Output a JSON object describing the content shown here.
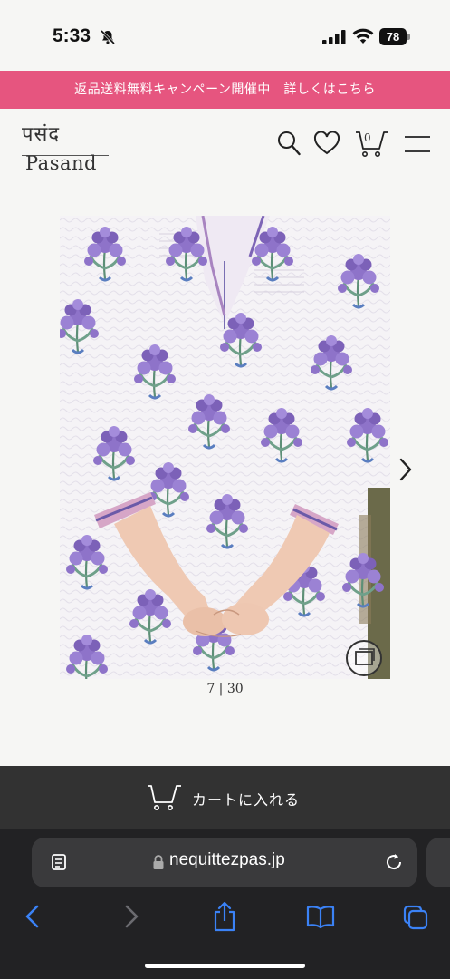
{
  "status_bar": {
    "time": "5:33",
    "battery": "78"
  },
  "promo": {
    "text": "返品送料無料キャンペーン開催中　詳しくはこちら"
  },
  "brand": {
    "hindi": "पसंद",
    "latin": "Pasand"
  },
  "header": {
    "cart_count": "0"
  },
  "gallery": {
    "counter": "7 | 30"
  },
  "cart_bar": {
    "label": "カートに入れる"
  },
  "browser": {
    "url": "nequittezpas.jp"
  },
  "icons": {
    "bell": "bell-slash-icon",
    "signal": "signal-icon",
    "wifi": "wifi-icon",
    "search": "search-icon",
    "heart": "heart-icon",
    "cart": "cart-icon",
    "menu": "menu-icon",
    "next": "chevron-right-icon",
    "zoom": "expand-icon",
    "reader": "page-menu-icon",
    "lock": "lock-icon",
    "reload": "reload-icon",
    "back": "back-icon",
    "forward": "forward-icon",
    "share": "share-icon",
    "bookmarks": "bookmarks-icon",
    "tabs": "tabs-icon"
  },
  "colors": {
    "promo_bg": "#e6557f",
    "cart_bar_bg": "#323232",
    "browser_bg": "#222224"
  }
}
